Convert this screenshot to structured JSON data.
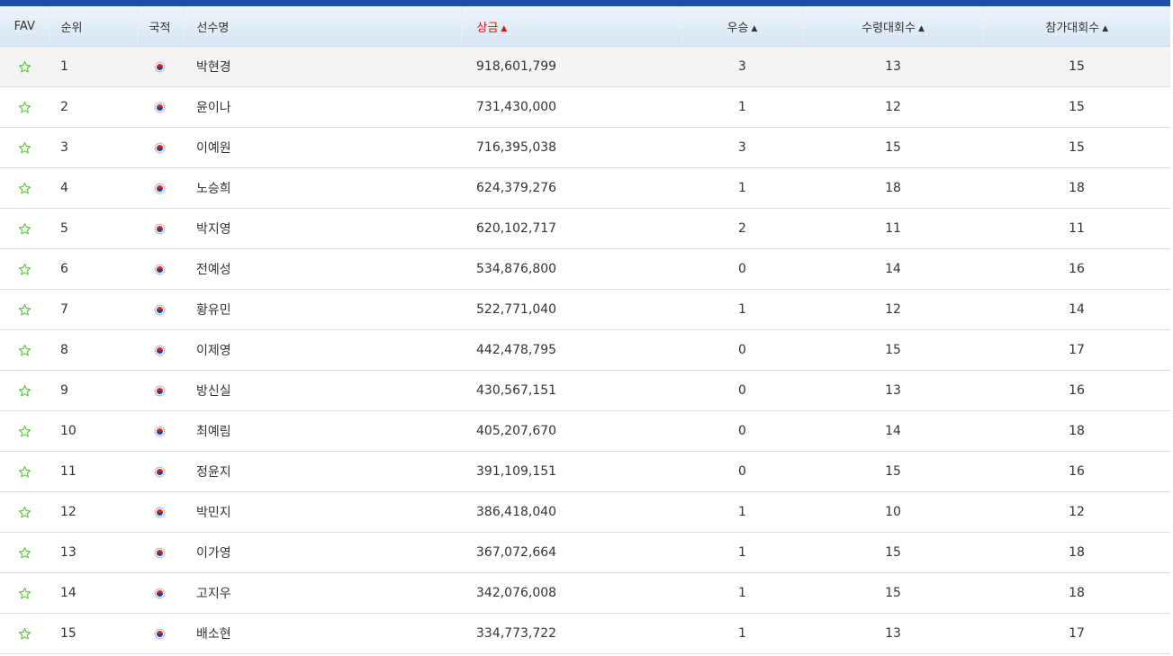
{
  "colors": {
    "accent_bar": "#1b4fa8",
    "sort_active": "#e11010",
    "fav_star": "#5cc23a"
  },
  "header": {
    "fav": "FAV",
    "rank": "순위",
    "nationality": "국적",
    "player": "선수명",
    "prize": "상금",
    "wins": "우승",
    "paid_events": "수령대회수",
    "events_played": "참가대회수",
    "sort_arrow": "▲"
  },
  "rows": [
    {
      "rank": "1",
      "country": "korea-flag-icon",
      "name": "박현경",
      "prize": "918,601,799",
      "wins": "3",
      "paid": "13",
      "played": "15"
    },
    {
      "rank": "2",
      "country": "korea-flag-icon",
      "name": "윤이나",
      "prize": "731,430,000",
      "wins": "1",
      "paid": "12",
      "played": "15"
    },
    {
      "rank": "3",
      "country": "korea-flag-icon",
      "name": "이예원",
      "prize": "716,395,038",
      "wins": "3",
      "paid": "15",
      "played": "15"
    },
    {
      "rank": "4",
      "country": "korea-flag-icon",
      "name": "노승희",
      "prize": "624,379,276",
      "wins": "1",
      "paid": "18",
      "played": "18"
    },
    {
      "rank": "5",
      "country": "korea-flag-icon",
      "name": "박지영",
      "prize": "620,102,717",
      "wins": "2",
      "paid": "11",
      "played": "11"
    },
    {
      "rank": "6",
      "country": "korea-flag-icon",
      "name": "전예성",
      "prize": "534,876,800",
      "wins": "0",
      "paid": "14",
      "played": "16"
    },
    {
      "rank": "7",
      "country": "korea-flag-icon",
      "name": "황유민",
      "prize": "522,771,040",
      "wins": "1",
      "paid": "12",
      "played": "14"
    },
    {
      "rank": "8",
      "country": "korea-flag-icon",
      "name": "이제영",
      "prize": "442,478,795",
      "wins": "0",
      "paid": "15",
      "played": "17"
    },
    {
      "rank": "9",
      "country": "korea-flag-icon",
      "name": "방신실",
      "prize": "430,567,151",
      "wins": "0",
      "paid": "13",
      "played": "16"
    },
    {
      "rank": "10",
      "country": "korea-flag-icon",
      "name": "최예림",
      "prize": "405,207,670",
      "wins": "0",
      "paid": "14",
      "played": "18"
    },
    {
      "rank": "11",
      "country": "korea-flag-icon",
      "name": "정윤지",
      "prize": "391,109,151",
      "wins": "0",
      "paid": "15",
      "played": "16"
    },
    {
      "rank": "12",
      "country": "korea-flag-icon",
      "name": "박민지",
      "prize": "386,418,040",
      "wins": "1",
      "paid": "10",
      "played": "12"
    },
    {
      "rank": "13",
      "country": "korea-flag-icon",
      "name": "이가영",
      "prize": "367,072,664",
      "wins": "1",
      "paid": "15",
      "played": "18"
    },
    {
      "rank": "14",
      "country": "korea-flag-icon",
      "name": "고지우",
      "prize": "342,076,008",
      "wins": "1",
      "paid": "15",
      "played": "18"
    },
    {
      "rank": "15",
      "country": "korea-flag-icon",
      "name": "배소현",
      "prize": "334,773,722",
      "wins": "1",
      "paid": "13",
      "played": "17"
    }
  ]
}
